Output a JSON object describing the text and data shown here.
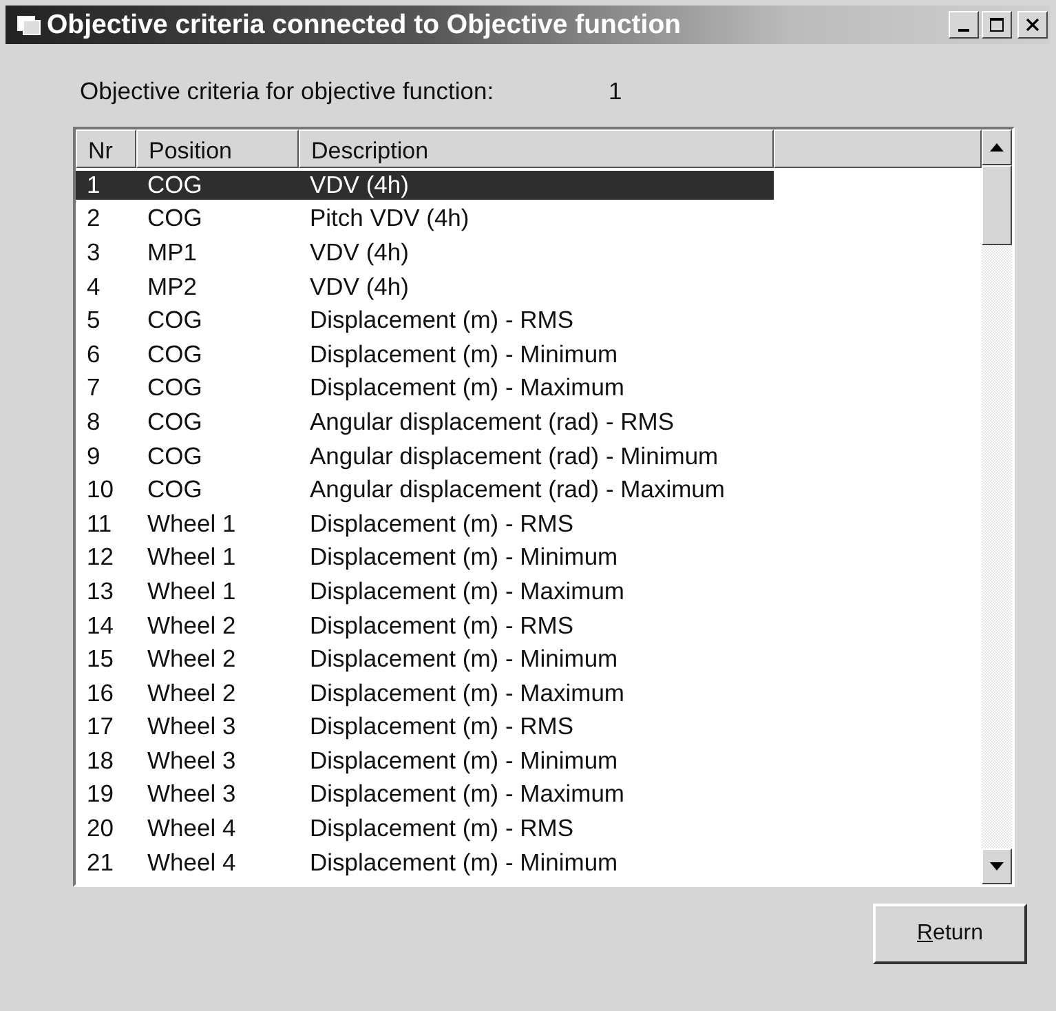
{
  "window": {
    "title": "Objective criteria connected to Objective function"
  },
  "summary": {
    "label": "Objective criteria for objective function:",
    "value": "1"
  },
  "table": {
    "columns": [
      "Nr",
      "Position",
      "Description"
    ],
    "rows": [
      {
        "nr": "1",
        "position": "COG",
        "description": "VDV (4h)",
        "selected": true
      },
      {
        "nr": "2",
        "position": "COG",
        "description": "Pitch VDV (4h)",
        "selected": false
      },
      {
        "nr": "3",
        "position": "MP1",
        "description": "VDV (4h)",
        "selected": false
      },
      {
        "nr": "4",
        "position": "MP2",
        "description": "VDV (4h)",
        "selected": false
      },
      {
        "nr": "5",
        "position": "COG",
        "description": "Displacement (m) - RMS",
        "selected": false
      },
      {
        "nr": "6",
        "position": "COG",
        "description": "Displacement (m) - Minimum",
        "selected": false
      },
      {
        "nr": "7",
        "position": "COG",
        "description": "Displacement (m) - Maximum",
        "selected": false
      },
      {
        "nr": "8",
        "position": "COG",
        "description": "Angular displacement (rad) - RMS",
        "selected": false
      },
      {
        "nr": "9",
        "position": "COG",
        "description": "Angular displacement (rad) - Minimum",
        "selected": false
      },
      {
        "nr": "10",
        "position": "COG",
        "description": "Angular displacement (rad) - Maximum",
        "selected": false
      },
      {
        "nr": "11",
        "position": "Wheel 1",
        "description": "Displacement (m) - RMS",
        "selected": false
      },
      {
        "nr": "12",
        "position": "Wheel 1",
        "description": "Displacement (m) - Minimum",
        "selected": false
      },
      {
        "nr": "13",
        "position": "Wheel 1",
        "description": "Displacement (m) - Maximum",
        "selected": false
      },
      {
        "nr": "14",
        "position": "Wheel 2",
        "description": "Displacement (m) - RMS",
        "selected": false
      },
      {
        "nr": "15",
        "position": "Wheel 2",
        "description": "Displacement (m) - Minimum",
        "selected": false
      },
      {
        "nr": "16",
        "position": "Wheel 2",
        "description": "Displacement (m) - Maximum",
        "selected": false
      },
      {
        "nr": "17",
        "position": "Wheel 3",
        "description": "Displacement (m) - RMS",
        "selected": false
      },
      {
        "nr": "18",
        "position": "Wheel 3",
        "description": "Displacement (m) - Minimum",
        "selected": false
      },
      {
        "nr": "19",
        "position": "Wheel 3",
        "description": "Displacement (m) - Maximum",
        "selected": false
      },
      {
        "nr": "20",
        "position": "Wheel 4",
        "description": "Displacement (m) - RMS",
        "selected": false
      },
      {
        "nr": "21",
        "position": "Wheel 4",
        "description": "Displacement (m) - Minimum",
        "selected": false
      }
    ]
  },
  "buttons": [
    "Return"
  ]
}
